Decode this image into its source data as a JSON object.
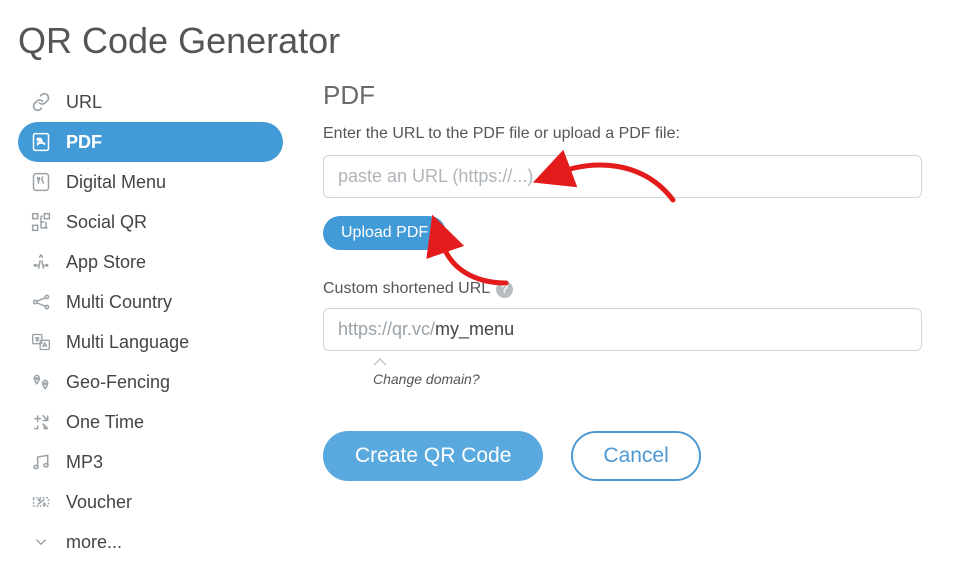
{
  "page_title": "QR Code Generator",
  "sidebar": {
    "items": [
      {
        "label": "URL"
      },
      {
        "label": "PDF"
      },
      {
        "label": "Digital Menu"
      },
      {
        "label": "Social QR"
      },
      {
        "label": "App Store"
      },
      {
        "label": "Multi Country"
      },
      {
        "label": "Multi Language"
      },
      {
        "label": "Geo-Fencing"
      },
      {
        "label": "One Time"
      },
      {
        "label": "MP3"
      },
      {
        "label": "Voucher"
      },
      {
        "label": "more..."
      }
    ],
    "active_index": 1
  },
  "main": {
    "title": "PDF",
    "url_field": {
      "label": "Enter the URL to the PDF file or upload a PDF file:",
      "placeholder": "paste an URL (https://...)",
      "value": ""
    },
    "upload_button_label": "Upload PDF",
    "custom_url": {
      "label": "Custom shortened URL",
      "prefix": "https://qr.vc/",
      "value": "my_menu",
      "change_domain_label": "Change domain?"
    },
    "actions": {
      "create_label": "Create QR Code",
      "cancel_label": "Cancel"
    }
  }
}
